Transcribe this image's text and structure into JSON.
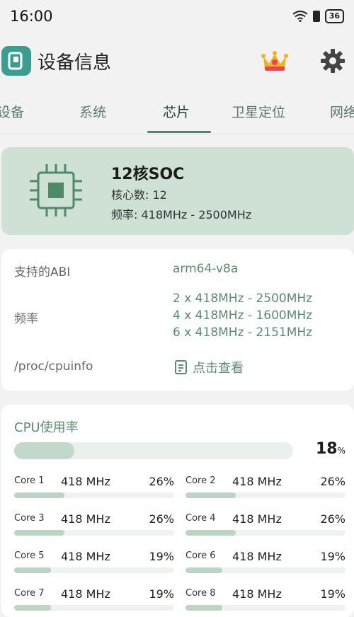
{
  "status_bar": {
    "time": "16:00",
    "battery": "36"
  },
  "header": {
    "title": "设备信息",
    "crown_icon": "crown-icon",
    "settings_icon": "gear-icon"
  },
  "tabs": [
    {
      "label": "设备"
    },
    {
      "label": "系统"
    },
    {
      "label": "芯片",
      "active": true
    },
    {
      "label": "卫星定位"
    },
    {
      "label": "网络"
    }
  ],
  "soc": {
    "title": "12核SOC",
    "cores_line": "核心数: 12",
    "freq_line": "频率: 418MHz - 2500MHz"
  },
  "info": {
    "abi_label": "支持的ABI",
    "abi_value": "arm64-v8a",
    "freq_label": "频率",
    "freq_values": [
      "2 x 418MHz - 2500MHz",
      "4 x 418MHz - 1600MHz",
      "6 x 418MHz - 2151MHz"
    ],
    "cpuinfo_label": "/proc/cpuinfo",
    "cpuinfo_link": "点击查看"
  },
  "cpu_usage": {
    "title": "CPU使用率",
    "total_percent": 18,
    "total_value": "18",
    "total_unit": "%",
    "cores": [
      {
        "name": "Core 1",
        "freq": "418 MHz",
        "percent": "26%",
        "level": 0.26
      },
      {
        "name": "Core 2",
        "freq": "418 MHz",
        "percent": "26%",
        "level": 0.26
      },
      {
        "name": "Core 3",
        "freq": "418 MHz",
        "percent": "26%",
        "level": 0.26
      },
      {
        "name": "Core 4",
        "freq": "418 MHz",
        "percent": "26%",
        "level": 0.26
      },
      {
        "name": "Core 5",
        "freq": "418 MHz",
        "percent": "19%",
        "level": 0.19
      },
      {
        "name": "Core 6",
        "freq": "418 MHz",
        "percent": "19%",
        "level": 0.19
      },
      {
        "name": "Core 7",
        "freq": "418 MHz",
        "percent": "19%",
        "level": 0.19
      },
      {
        "name": "Core 8",
        "freq": "418 MHz",
        "percent": "19%",
        "level": 0.19
      }
    ]
  },
  "colors": {
    "accent": "#5b8a76",
    "soc_card": "#cfe0d5",
    "logo": "#3a9d8f",
    "bar_fill": "#c2d8ca"
  }
}
